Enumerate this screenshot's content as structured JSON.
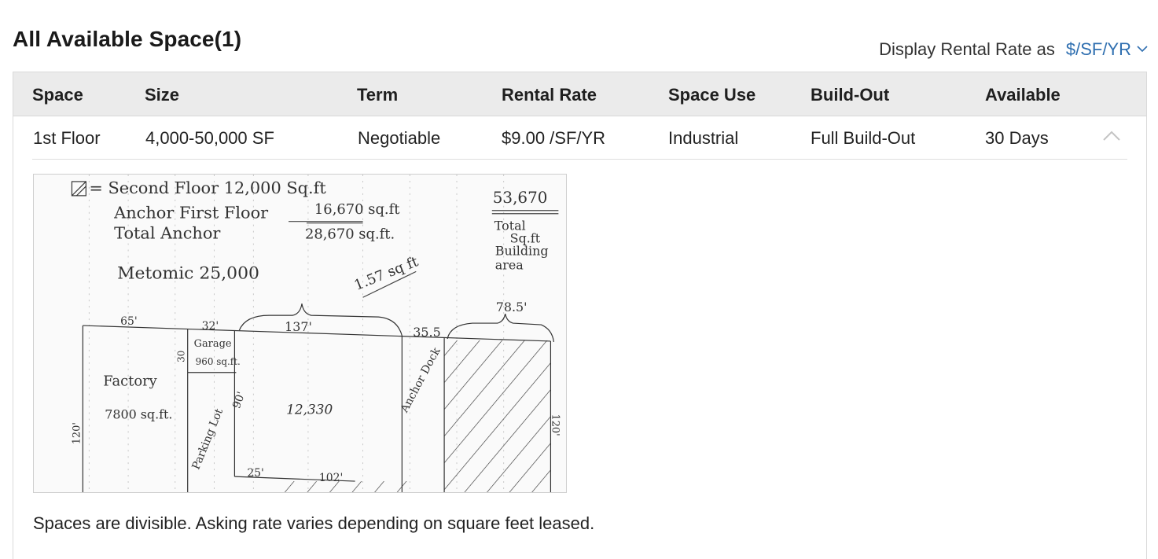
{
  "section": {
    "title": "All Available Space(1)",
    "rate_display_label": "Display Rental Rate as",
    "rate_display_value": "$/SF/YR"
  },
  "table": {
    "headers": [
      "Space",
      "Size",
      "Term",
      "Rental Rate",
      "Space Use",
      "Build-Out",
      "Available"
    ],
    "rows": [
      {
        "space": "1st Floor",
        "size": "4,000-50,000 SF",
        "term": "Negotiable",
        "rental_rate": "$9.00 /SF/YR",
        "space_use": "Industrial",
        "build_out": "Full Build-Out",
        "available": "30 Days"
      }
    ]
  },
  "floorplan": {
    "legend_second": "= Second Floor 12,000 Sq.ft",
    "anchor_first": "Anchor First Floor",
    "anchor_first_val": "16,670 sq.ft",
    "total_anchor": "Total Anchor",
    "total_anchor_val": "28,670 sq.ft.",
    "total_val": "53,670",
    "total_lines": [
      "Total",
      "Sq.ft",
      "Building",
      "area"
    ],
    "metomic": "Metomic 25,000",
    "rate_note": "1.57 sq ft",
    "dims": [
      "65'",
      "32'",
      "137'",
      "35.5",
      "78.5'",
      "30",
      "90'",
      "120'",
      "25'",
      "102'",
      "120'"
    ],
    "factory": "Factory",
    "factory_area": "7800 sq.ft.",
    "garage": "Garage",
    "garage_area": "960 sq.ft.",
    "center_area": "12,330",
    "parking": "Parking Lot",
    "anchor_dock": "Anchor Dock"
  },
  "note": "Spaces are divisible. Asking rate varies depending on square feet leased."
}
